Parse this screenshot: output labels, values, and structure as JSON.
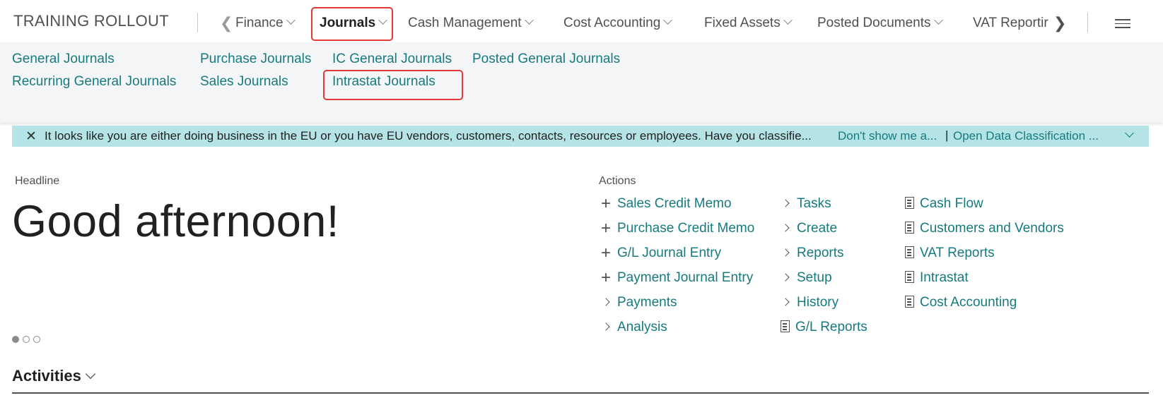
{
  "company": "TRAINING ROLLOUT",
  "nav": {
    "items": [
      {
        "label": "Finance"
      },
      {
        "label": "Journals"
      },
      {
        "label": "Cash Management"
      },
      {
        "label": "Cost Accounting"
      },
      {
        "label": "Fixed Assets"
      },
      {
        "label": "Posted Documents"
      },
      {
        "label": "VAT Reportir"
      }
    ],
    "active": "Journals"
  },
  "submenu": {
    "links": [
      "General Journals",
      "Recurring General Journals",
      "Purchase Journals",
      "Sales Journals",
      "IC General Journals",
      "Intrastat Journals",
      "Posted General Journals"
    ]
  },
  "banner": {
    "message": "It looks like you are either doing business in the EU or you have EU vendors, customers, contacts, resources or employees. Have you classifie...",
    "action1": "Don't show me a...",
    "separator": "|",
    "action2": "Open Data Classification ..."
  },
  "headline": {
    "label": "Headline",
    "greeting": "Good afternoon!",
    "pages": 3,
    "current_page": 1
  },
  "actions": {
    "label": "Actions",
    "create_items": [
      "Sales Credit Memo",
      "Purchase Credit Memo",
      "G/L Journal Entry",
      "Payment Journal Entry"
    ],
    "group_col1": [
      "Payments",
      "Analysis"
    ],
    "group_col2": [
      "Tasks",
      "Create",
      "Reports",
      "Setup",
      "History"
    ],
    "report_col2": [
      "G/L Reports"
    ],
    "report_col3": [
      "Cash Flow",
      "Customers and Vendors",
      "VAT Reports",
      "Intrastat",
      "Cost Accounting"
    ]
  },
  "activities": {
    "title": "Activities"
  },
  "colors": {
    "link": "#177a7f",
    "banner_bg": "#b4e4e6",
    "highlight": "#e53935",
    "submenu_bg": "#f4f5f6"
  }
}
